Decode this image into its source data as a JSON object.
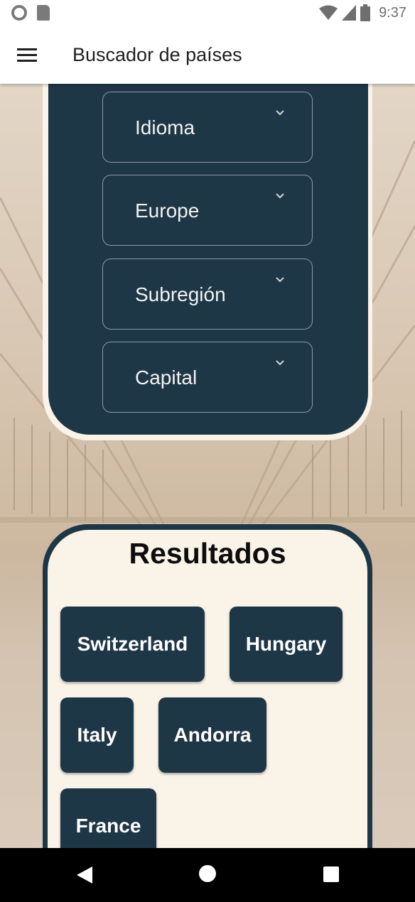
{
  "status_bar": {
    "time": "9:37"
  },
  "app_bar": {
    "title": "Buscador de países"
  },
  "filters": [
    {
      "label": "Idioma"
    },
    {
      "label": "Europe"
    },
    {
      "label": "Subregión"
    },
    {
      "label": "Capital"
    }
  ],
  "results": {
    "title": "Resultados",
    "items": [
      "Switzerland",
      "Hungary",
      "Italy",
      "Andorra",
      "France"
    ]
  },
  "colors": {
    "panel": "#1e3747",
    "cream": "#faf3e7",
    "appbar": "#ffffff"
  }
}
